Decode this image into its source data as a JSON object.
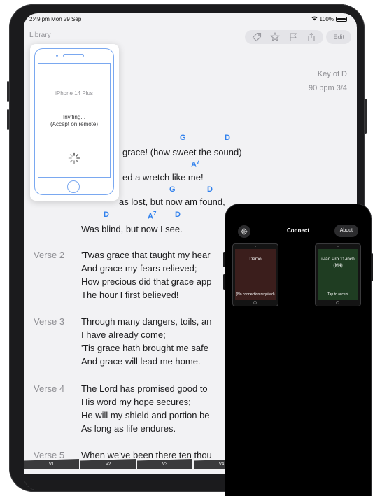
{
  "status": {
    "time": "2:49 pm  Mon 29 Sep",
    "battery": "100%"
  },
  "nav": {
    "back_label": "Library",
    "edit_label": "Edit"
  },
  "song": {
    "key": "Key of D",
    "tempo_meter": "90 bpm   3/4"
  },
  "chords": {
    "c1": "G",
    "c2": "D",
    "c3": "A",
    "c4": "7",
    "c5": "G",
    "c6": "D",
    "c7": "D",
    "c8": "A",
    "c9": "7",
    "c10": "D"
  },
  "verse1": {
    "line1": "grace! (how sweet the sound)",
    "line2": "ed a wretch like me!",
    "line3": "as lost, but now am found,",
    "line4": "Was blind, but now I see."
  },
  "verses": [
    {
      "label": "Verse 2",
      "lines": [
        "'Twas grace that taught my hear",
        "And grace my fears relieved;",
        "How precious did that grace app",
        "The hour I first believed!"
      ]
    },
    {
      "label": "Verse 3",
      "lines": [
        "Through many dangers, toils, an",
        "I have already come;",
        "'Tis grace hath brought me safe",
        "And grace will lead me home."
      ]
    },
    {
      "label": "Verse 4",
      "lines": [
        "The Lord has promised good to",
        "His word my hope secures;",
        "He will my shield and portion be",
        "As long as life endures."
      ]
    },
    {
      "label": "Verse 5",
      "lines": [
        "When we've been there ten thou"
      ]
    }
  ],
  "verse_tabs": [
    "V1",
    "V2",
    "V3",
    "V4"
  ],
  "invite": {
    "device": "iPhone 14 Plus",
    "status": "Inviting...",
    "hint": "(Accept on remote)"
  },
  "connect": {
    "title": "Connect",
    "about": "About",
    "devices": [
      {
        "name": "Demo",
        "note": "(No connection required)",
        "color": "#3b1e1c"
      },
      {
        "name": "iPad Pro 11-inch (M4)",
        "note": "Tap to accept",
        "color": "#1f3d22"
      }
    ]
  },
  "colors": {
    "chord": "#2f80ed",
    "accent_outline": "#7aa8f0"
  }
}
